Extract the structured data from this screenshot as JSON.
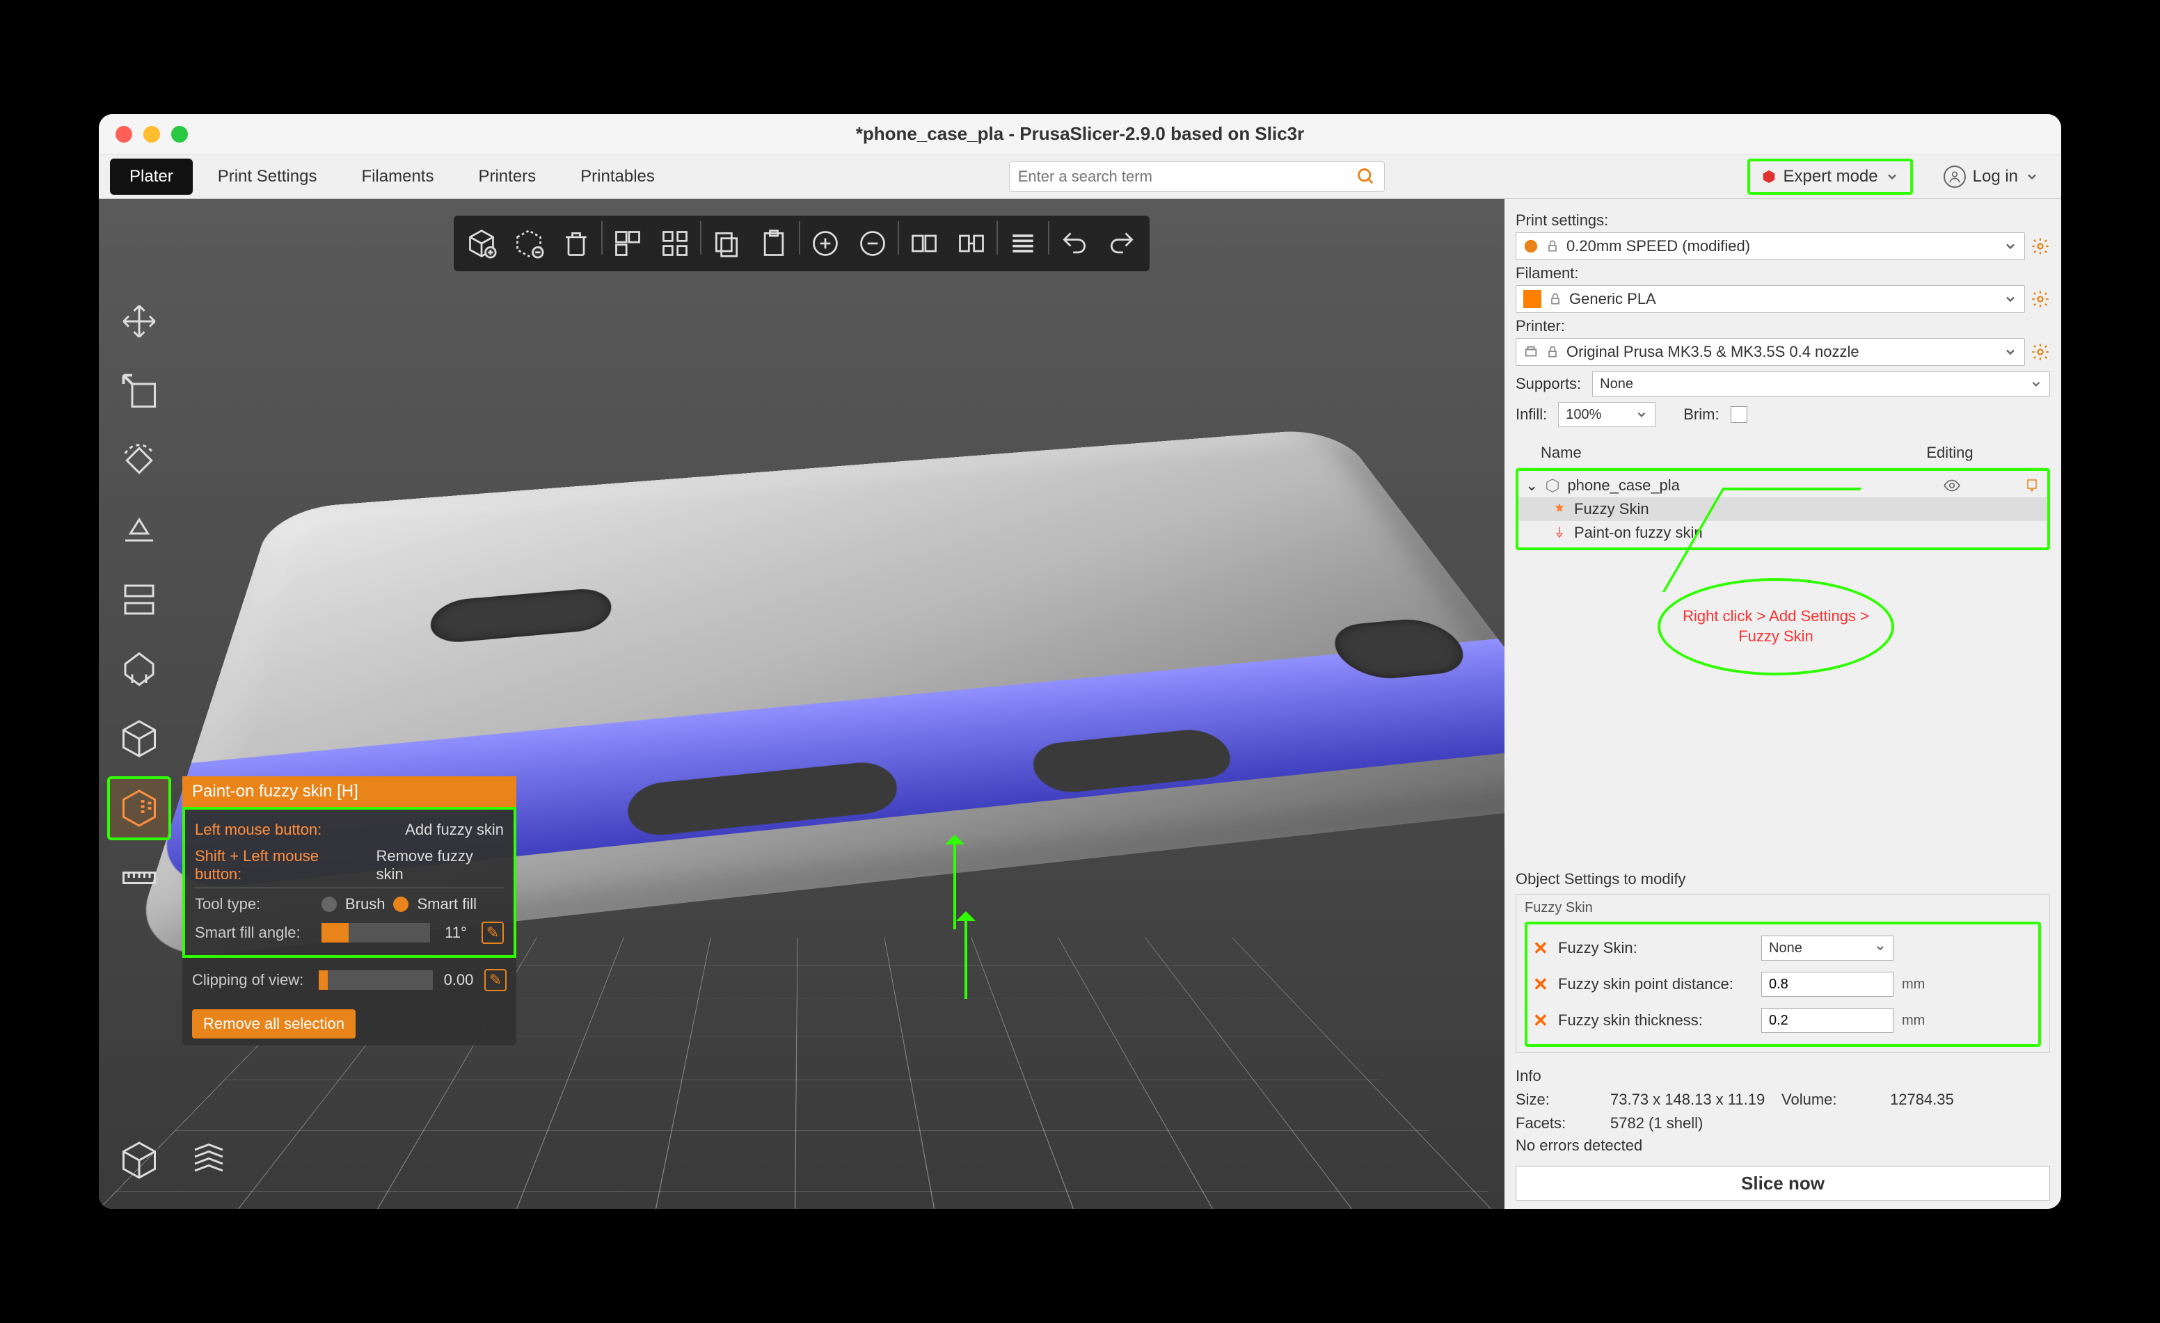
{
  "window": {
    "title": "*phone_case_pla - PrusaSlicer-2.9.0 based on Slic3r"
  },
  "tabs": {
    "plater": "Plater",
    "print": "Print Settings",
    "filaments": "Filaments",
    "printers": "Printers",
    "printables": "Printables"
  },
  "search": {
    "placeholder": "Enter a search term"
  },
  "mode": {
    "label": "Expert mode"
  },
  "login": {
    "label": "Log in"
  },
  "gizmo": {
    "title": "Paint-on fuzzy skin [H]",
    "lmb_label": "Left mouse button:",
    "lmb_action": "Add fuzzy skin",
    "shift_label": "Shift + Left mouse button:",
    "shift_action": "Remove fuzzy skin",
    "tool_label": "Tool type:",
    "brush": "Brush",
    "smart": "Smart fill",
    "angle_label": "Smart fill angle:",
    "angle_value": "11°",
    "clip_label": "Clipping of view:",
    "clip_value": "0.00",
    "remove_all": "Remove all selection"
  },
  "right": {
    "print_settings_label": "Print settings:",
    "print_settings_value": "0.20mm SPEED (modified)",
    "filament_label": "Filament:",
    "filament_value": "Generic PLA",
    "printer_label": "Printer:",
    "printer_value": "Original Prusa MK3.5 & MK3.5S 0.4 nozzle",
    "supports_label": "Supports:",
    "supports_value": "None",
    "infill_label": "Infill:",
    "infill_value": "100%",
    "brim_label": "Brim:",
    "tree_name": "Name",
    "tree_edit": "Editing",
    "tree_root": "phone_case_pla",
    "tree_child1": "Fuzzy Skin",
    "tree_child2": "Paint-on fuzzy skin",
    "callout": "Right click > Add Settings > Fuzzy Skin",
    "obj_settings": "Object Settings to modify",
    "fuzzy_group": "Fuzzy Skin",
    "fuzzy_skin_label": "Fuzzy Skin:",
    "fuzzy_skin_value": "None",
    "fuzzy_dist_label": "Fuzzy skin point distance:",
    "fuzzy_dist_value": "0.8",
    "fuzzy_thick_label": "Fuzzy skin thickness:",
    "fuzzy_thick_value": "0.2",
    "unit_mm": "mm",
    "info_title": "Info",
    "size_label": "Size:",
    "size_value": "73.73 x 148.13 x 11.19",
    "volume_label": "Volume:",
    "volume_value": "12784.35",
    "facets_label": "Facets:",
    "facets_value": "5782 (1 shell)",
    "no_errors": "No errors detected",
    "slice": "Slice now"
  }
}
